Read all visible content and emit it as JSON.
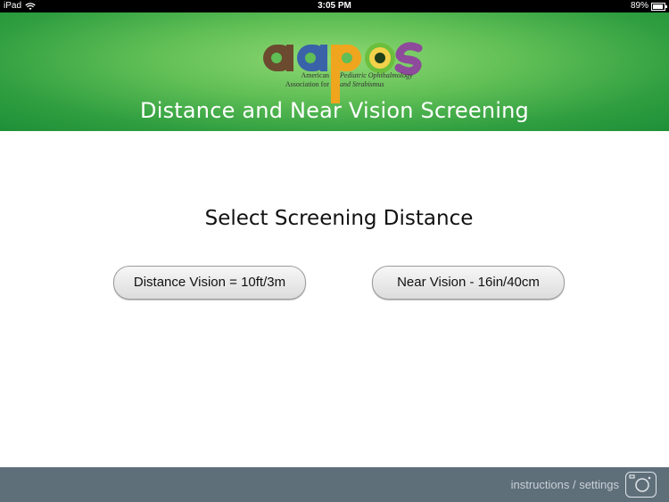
{
  "status_bar": {
    "carrier": "iPad",
    "time": "3:05 PM",
    "battery": "89%"
  },
  "header": {
    "logo_text": "aapos",
    "org_left": [
      "American",
      "Association for"
    ],
    "org_right": [
      "Pediatric Ophthalmology",
      "and Strabismus"
    ],
    "title": "Distance and Near Vision Screening",
    "logo_colors": {
      "a1": "#6b4a2f",
      "a2": "#3a62a8",
      "p": "#f0a51e",
      "o": "#6bbf3d",
      "s": "#8e4a9b"
    }
  },
  "main": {
    "title": "Select Screening Distance",
    "buttons": {
      "distance": "Distance Vision = 10ft/3m",
      "near": "Near Vision - 16in/40cm"
    }
  },
  "footer": {
    "link": "instructions / settings",
    "icon": "camera-icon"
  }
}
